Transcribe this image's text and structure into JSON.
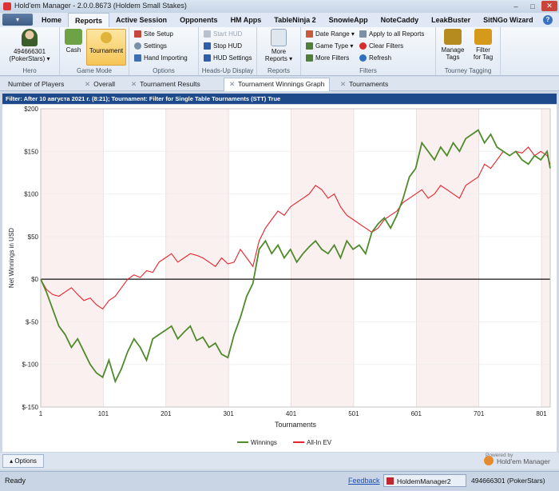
{
  "window": {
    "title": "Hold'em Manager - 2.0.0.8673 (Holdem Small Stakes)",
    "buttons": {
      "minimize": "–",
      "maximize": "□",
      "close": "✕"
    }
  },
  "menu": {
    "app_menu_label": "▾",
    "tabs": [
      "Home",
      "Reports",
      "Active Session",
      "Opponents",
      "HM Apps",
      "TableNinja 2",
      "SnowieApp",
      "NoteCaddy",
      "LeakBuster",
      "SitNGo Wizard"
    ],
    "active_tab": "Reports",
    "help": "?"
  },
  "ribbon": {
    "hero": {
      "player": "494666301",
      "site": "(PokerStars) ▾",
      "label": "Hero"
    },
    "game_mode": {
      "cash": "Cash",
      "tournament": "Tournament",
      "label": "Game Mode"
    },
    "options": {
      "site_setup": "Site Setup",
      "settings": "Settings",
      "hand_importing": "Hand Importing",
      "label": "Options"
    },
    "hud": {
      "start": "Start HUD",
      "stop": "Stop HUD",
      "settings": "HUD Settings",
      "label": "Heads-Up Display"
    },
    "reports": {
      "more": "More",
      "reports": "Reports ▾",
      "label": "Reports"
    },
    "filters": {
      "date_range": "Date Range ▾",
      "game_type": "Game Type ▾",
      "more_filters": "More Filters",
      "apply_all": "Apply to all Reports",
      "clear": "Clear Filters",
      "refresh": "Refresh",
      "label": "Filters"
    },
    "tagging": {
      "manage": "Manage",
      "tags": "Tags",
      "filter": "Filter",
      "for_tag": "for Tag",
      "label": "Tourney Tagging"
    }
  },
  "report_tabs": [
    "Number of Players",
    "Overall",
    "Tournament Results",
    "Tournament Winnings Graph",
    "Tournaments"
  ],
  "active_report_tab": "Tournament Winnings Graph",
  "filter_text": "Filter: After 10 августа 2021 г. (8:21); Tournament: Filter for Single Table Tournaments (STT) True",
  "chart_data": {
    "type": "line",
    "xlabel": "Tournaments",
    "ylabel": "Net Winnings in USD",
    "xticks": [
      1,
      101,
      201,
      301,
      401,
      501,
      601,
      701,
      801
    ],
    "yticks": [
      "$200",
      "$150",
      "$100",
      "$50",
      "$0",
      "$-50",
      "$-100",
      "$-150"
    ],
    "ylim": [
      -150,
      200
    ],
    "xlim": [
      1,
      815
    ],
    "series": [
      {
        "name": "Winnings",
        "color": "#4f8a2b",
        "x": [
          1,
          10,
          20,
          30,
          40,
          50,
          60,
          70,
          80,
          90,
          100,
          110,
          120,
          130,
          140,
          150,
          160,
          170,
          180,
          190,
          200,
          210,
          220,
          230,
          240,
          250,
          260,
          270,
          280,
          290,
          300,
          310,
          320,
          330,
          340,
          350,
          360,
          370,
          380,
          390,
          400,
          410,
          420,
          430,
          440,
          450,
          460,
          470,
          480,
          490,
          500,
          510,
          520,
          530,
          540,
          550,
          560,
          570,
          580,
          590,
          600,
          610,
          620,
          630,
          640,
          650,
          660,
          670,
          680,
          690,
          700,
          710,
          720,
          730,
          740,
          750,
          760,
          770,
          780,
          790,
          800,
          810,
          815
        ],
        "y": [
          0,
          -15,
          -35,
          -55,
          -65,
          -80,
          -70,
          -85,
          -100,
          -110,
          -115,
          -95,
          -120,
          -105,
          -85,
          -70,
          -80,
          -95,
          -70,
          -65,
          -60,
          -55,
          -70,
          -62,
          -55,
          -72,
          -68,
          -80,
          -75,
          -88,
          -92,
          -65,
          -45,
          -20,
          -5,
          35,
          45,
          30,
          40,
          25,
          35,
          20,
          30,
          38,
          45,
          35,
          30,
          40,
          25,
          45,
          35,
          40,
          30,
          55,
          65,
          72,
          60,
          75,
          95,
          120,
          130,
          160,
          150,
          140,
          155,
          145,
          160,
          150,
          165,
          170,
          175,
          160,
          170,
          155,
          150,
          145,
          150,
          140,
          135,
          145,
          140,
          150,
          130
        ]
      },
      {
        "name": "All-In EV",
        "color": "#e8232b",
        "x": [
          1,
          10,
          20,
          30,
          40,
          50,
          60,
          70,
          80,
          90,
          100,
          110,
          120,
          130,
          140,
          150,
          160,
          170,
          180,
          190,
          200,
          210,
          220,
          230,
          240,
          250,
          260,
          270,
          280,
          290,
          300,
          310,
          320,
          330,
          340,
          350,
          360,
          370,
          380,
          390,
          400,
          410,
          420,
          430,
          440,
          450,
          460,
          470,
          480,
          490,
          500,
          510,
          520,
          530,
          540,
          550,
          560,
          570,
          580,
          590,
          600,
          610,
          620,
          630,
          640,
          650,
          660,
          670,
          680,
          690,
          700,
          710,
          720,
          730,
          740,
          750,
          760,
          770,
          780,
          790,
          800,
          810,
          815
        ],
        "y": [
          0,
          -12,
          -18,
          -20,
          -15,
          -10,
          -18,
          -25,
          -22,
          -30,
          -35,
          -25,
          -20,
          -10,
          0,
          5,
          2,
          10,
          8,
          20,
          25,
          30,
          20,
          25,
          30,
          28,
          25,
          20,
          15,
          25,
          18,
          20,
          35,
          25,
          15,
          45,
          60,
          70,
          80,
          75,
          85,
          90,
          95,
          100,
          110,
          105,
          95,
          100,
          85,
          75,
          70,
          65,
          60,
          55,
          60,
          70,
          75,
          80,
          90,
          95,
          100,
          105,
          95,
          100,
          110,
          105,
          100,
          95,
          110,
          115,
          120,
          135,
          130,
          140,
          150,
          145,
          150,
          148,
          155,
          145,
          150,
          145,
          135
        ]
      }
    ],
    "grid": true,
    "legend_position": "bottom-center"
  },
  "options_button": "Options",
  "powered_by": {
    "small": "Powered by",
    "brand": "Hold'em Manager"
  },
  "status": {
    "ready": "Ready",
    "feedback": "Feedback",
    "instance": "HoldemManager2",
    "user": "494666301 (PokerStars)"
  }
}
